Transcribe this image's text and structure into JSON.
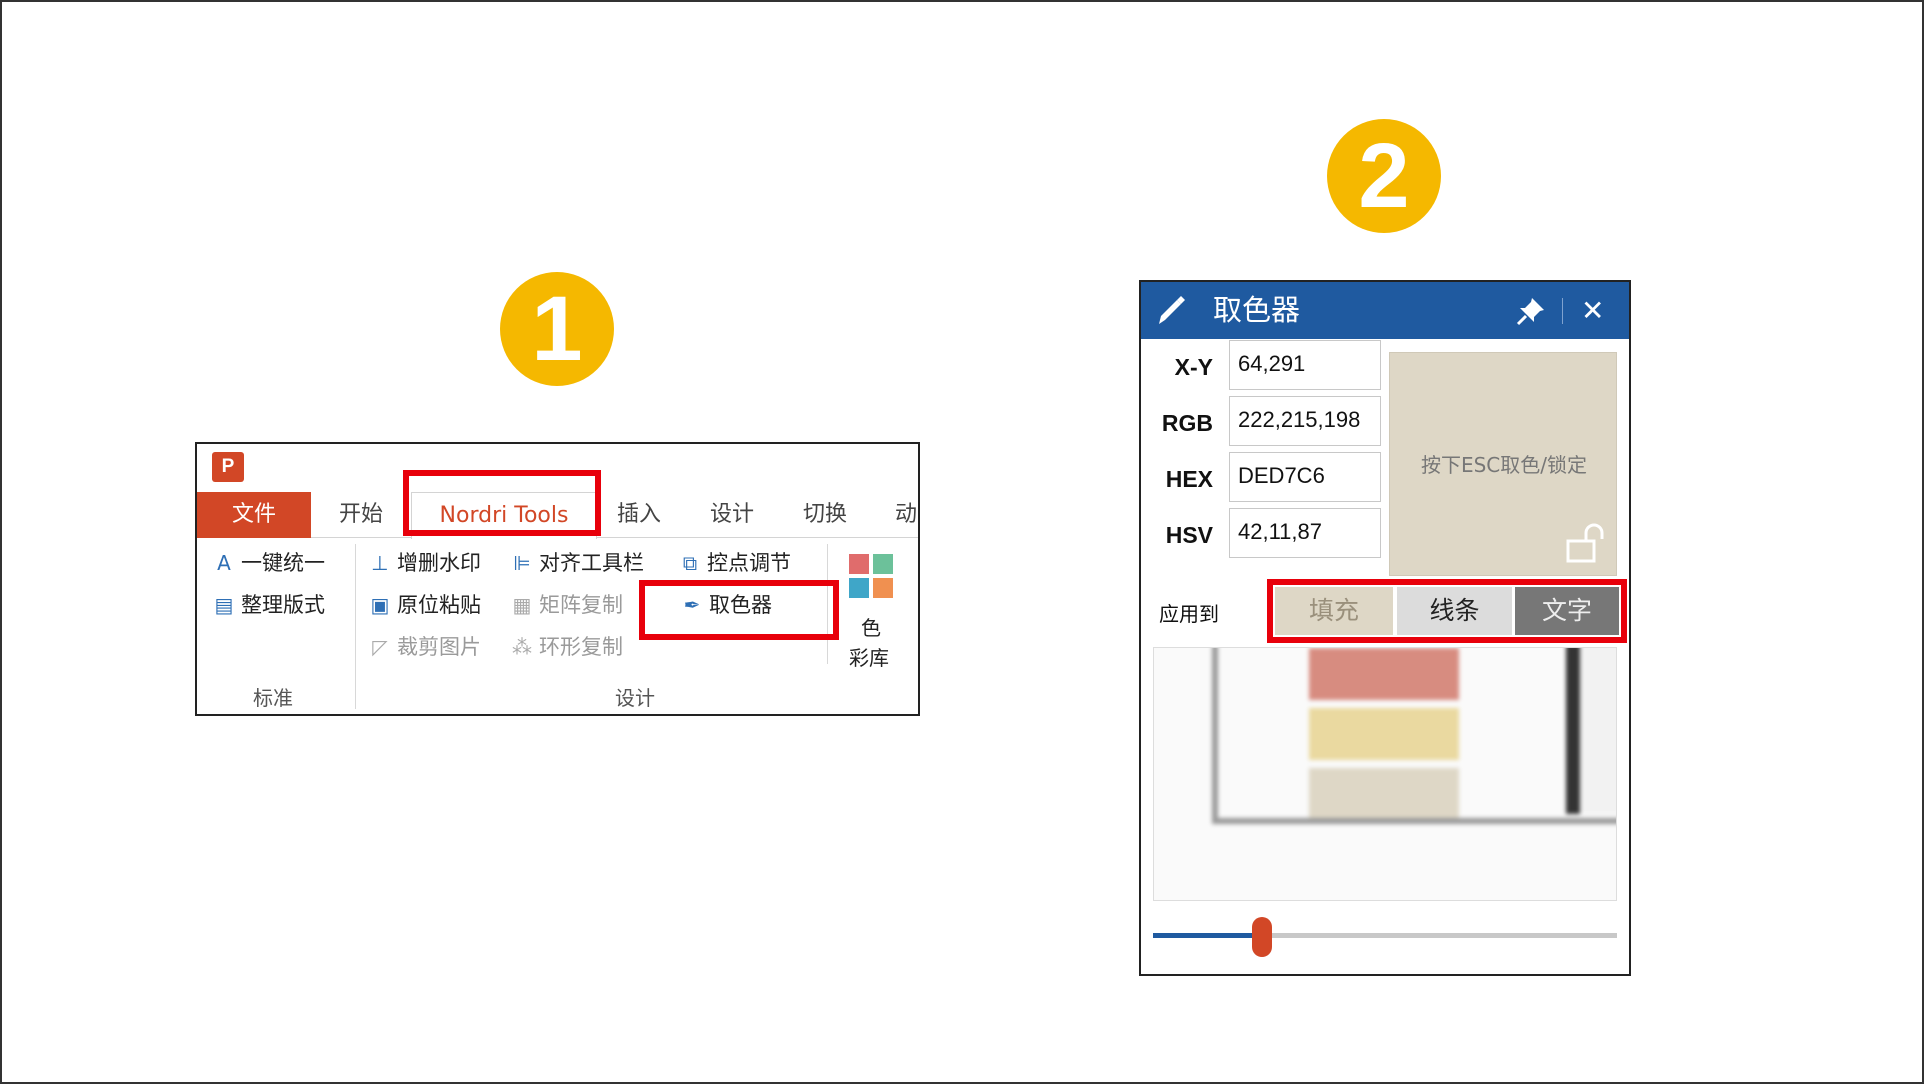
{
  "steps": {
    "step1": "1",
    "step2": "2"
  },
  "ribbon": {
    "app_logo": "P",
    "tabs": {
      "file": "文件",
      "home": "开始",
      "nordri": "Nordri Tools",
      "insert": "插入",
      "design": "设计",
      "transitions": "切换",
      "animations": "动"
    },
    "buttons": {
      "unify": "一键统一",
      "tidy": "整理版式",
      "watermark": "增删水印",
      "paste_in_place": "原位粘贴",
      "crop_image": "裁剪图片",
      "align_toolbar": "对齐工具栏",
      "matrix_copy": "矩阵复制",
      "ring_copy": "环形复制",
      "point_adjust": "控点调节",
      "color_picker": "取色器",
      "color": "色",
      "palette": "彩库"
    },
    "groups": {
      "standard": "标准",
      "design": "设计"
    },
    "swatch_colors": [
      "#e06c6c",
      "#6cc19a",
      "#3fa6c8",
      "#f09050"
    ]
  },
  "picker": {
    "title": "取色器",
    "fields": [
      {
        "label": "X-Y",
        "value": "64,291"
      },
      {
        "label": "RGB",
        "value": "222,215,198"
      },
      {
        "label": "HEX",
        "value": "DED7C6"
      },
      {
        "label": "HSV",
        "value": "42,11,87"
      }
    ],
    "preview_color": "#ded7c6",
    "preview_hint": "按下ESC取色/锁定",
    "apply_to": "应用到",
    "apply_buttons": {
      "fill": "填充",
      "line": "线条",
      "text": "文字"
    },
    "slider_value": 0.23
  },
  "colors": {
    "accent_red": "#d24726",
    "header_blue": "#1f5aa0",
    "step_yellow": "#f5b800",
    "highlight": "#e8000b"
  }
}
